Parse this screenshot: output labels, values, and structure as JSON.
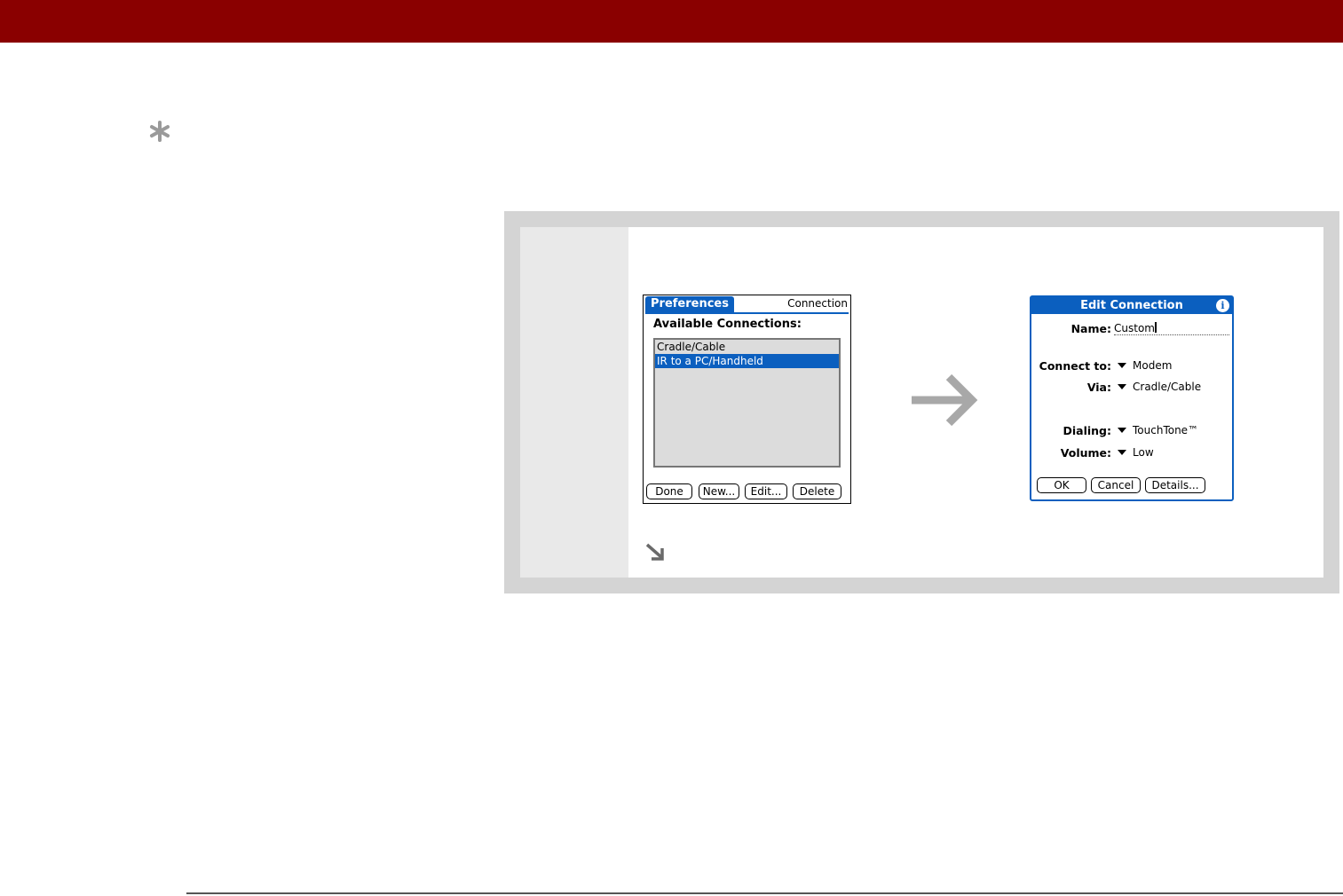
{
  "icons": {
    "tip": "asterisk-tip-icon",
    "flow": "right-arrow-icon",
    "continued": "down-right-arrow-icon",
    "info": "info-icon"
  },
  "colors": {
    "header": "#8a0000",
    "palm_accent": "#0b5fbf",
    "frame": "#d4d4d4"
  },
  "screen1": {
    "tab": "Preferences",
    "panel": "Connection",
    "heading": "Available Connections:",
    "items": [
      "Cradle/Cable",
      "IR to a PC/Handheld"
    ],
    "buttons": [
      "Done",
      "New...",
      "Edit...",
      "Delete"
    ]
  },
  "screen2": {
    "title": "Edit Connection",
    "info": "i",
    "name_label": "Name:",
    "name_value": "Custom",
    "connect_label": "Connect to:",
    "connect_value": "Modem",
    "via_label": "Via:",
    "via_value": "Cradle/Cable",
    "dialing_label": "Dialing:",
    "dialing_value": "TouchTone™",
    "volume_label": "Volume:",
    "volume_value": "Low",
    "buttons": [
      "OK",
      "Cancel",
      "Details..."
    ]
  }
}
